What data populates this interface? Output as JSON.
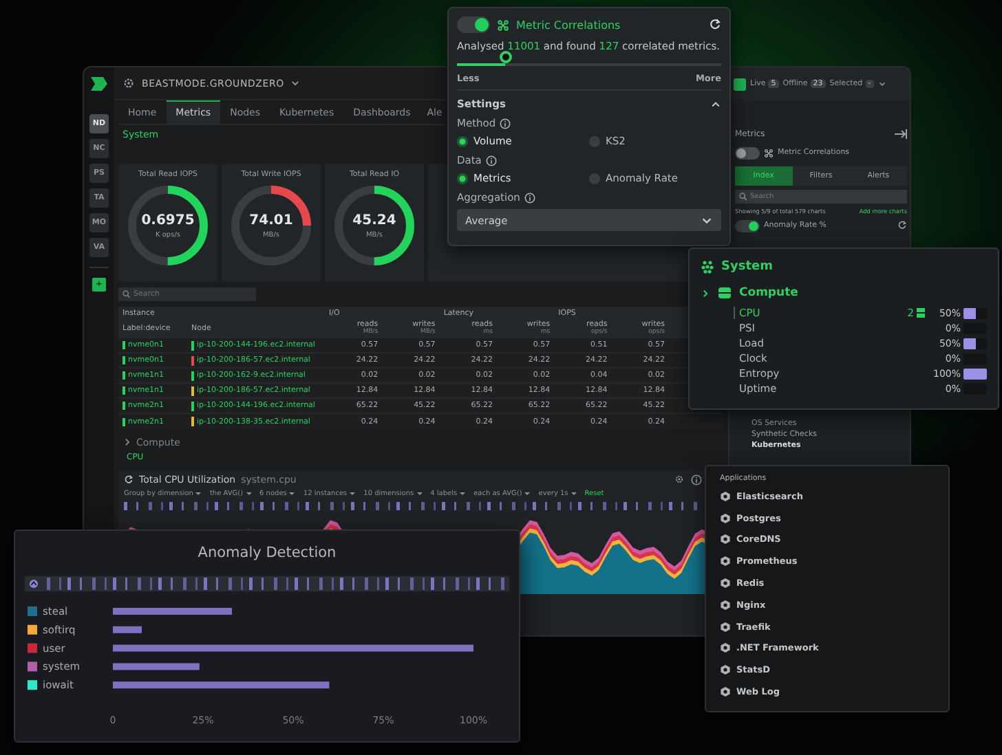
{
  "dashboard": {
    "space_name": "BEASTMODE.GROUNDZERO",
    "node_badges": [
      {
        "label": "ND",
        "selected": true
      },
      {
        "label": "NC",
        "selected": false
      },
      {
        "label": "PS",
        "selected": false
      },
      {
        "label": "TA",
        "selected": false
      },
      {
        "label": "MO",
        "selected": false
      },
      {
        "label": "VA",
        "selected": false
      }
    ],
    "add_button": "+",
    "tabs": [
      {
        "label": "Home",
        "selected": false
      },
      {
        "label": "Metrics",
        "selected": true
      },
      {
        "label": "Nodes",
        "selected": false
      },
      {
        "label": "Kubernetes",
        "selected": false
      },
      {
        "label": "Dashboards",
        "selected": false
      },
      {
        "label": "Ale",
        "selected": false
      }
    ],
    "breadcrumb": "System",
    "gauges": [
      {
        "title": "Total Read IOPS",
        "value": "0.6975",
        "unit": "K ops/s",
        "level": 0.5,
        "color": "#22d35c"
      },
      {
        "title": "Total Write IOPS",
        "value": "74.01",
        "unit": "MB/s",
        "level": 0.25,
        "color": "#e5484d"
      },
      {
        "title": "Total Read IO",
        "value": "45.24",
        "unit": "MB/s",
        "level": 0.5,
        "color": "#22d35c"
      }
    ],
    "search": {
      "placeholder": "Search"
    },
    "table": {
      "groups": [
        "Instance",
        "I/O",
        "Latency",
        "IOPS"
      ],
      "columns": [
        {
          "label": "Label:device"
        },
        {
          "label": "Node"
        },
        {
          "label": "reads",
          "unit": "MB/s"
        },
        {
          "label": "writes",
          "unit": "MB/s"
        },
        {
          "label": "reads",
          "unit": "ms"
        },
        {
          "label": "writes",
          "unit": "ms"
        },
        {
          "label": "reads",
          "unit": "ops/s"
        },
        {
          "label": "writes",
          "unit": "ops/s"
        }
      ],
      "rows": [
        {
          "device": "nvme0n1",
          "node": "ip-10-200-144-196.ec2.internal",
          "color": "#22d35c",
          "values": [
            "0.57",
            "0.57",
            "0.57",
            "0.57",
            "0.51",
            "0.57"
          ]
        },
        {
          "device": "nvme0n1",
          "node": "ip-10-200-186-57.ec2.internal",
          "color": "#e5484d",
          "values": [
            "24.22",
            "24.22",
            "24.22",
            "24.22",
            "24.22",
            "24.22"
          ]
        },
        {
          "device": "nvme1n1",
          "node": "ip-10-200-162-9.ec2.internal",
          "color": "#22d35c",
          "values": [
            "0.02",
            "0.02",
            "0.02",
            "0.02",
            "0.04",
            "0.02"
          ]
        },
        {
          "device": "nvme1n1",
          "node": "ip-10-200-186-57.ec2.internal",
          "color": "#e5b73b",
          "values": [
            "12.84",
            "12.84",
            "12.84",
            "12.84",
            "12.84",
            "12.84"
          ]
        },
        {
          "device": "nvme2n1",
          "node": "ip-10-200-144-196.ec2.internal",
          "color": "#22d35c",
          "values": [
            "65.22",
            "45.22",
            "65.22",
            "65.22",
            "65.22",
            "45.22"
          ]
        },
        {
          "device": "nvme2n1",
          "node": "ip-10-200-138-35.ec2.internal",
          "color": "#e5b73b",
          "values": [
            "0.24",
            "0.24",
            "0.24",
            "0.24",
            "0.24",
            "0.24"
          ]
        }
      ]
    },
    "section": "Compute",
    "subsection": "CPU",
    "chart": {
      "title": "Total CPU Utilization",
      "context": "system.cpu",
      "filters": [
        "Group by dimension",
        "the AVG()",
        "6 nodes",
        "12 instances",
        "10 dimensions",
        "4 labels",
        "each as AVG()",
        "every 1s"
      ],
      "reset": "Reset"
    }
  },
  "status": {
    "live_label": "Live",
    "live_count": "5",
    "offline_label": "Offline",
    "offline_count": "23",
    "selected_label": "Selected",
    "selected_value": "-"
  },
  "right_panel": {
    "title": "Metrics",
    "correlations_toggle": {
      "label": "Metric Correlations",
      "on": false
    },
    "tabs": [
      {
        "label": "Index",
        "selected": true
      },
      {
        "label": "Filters",
        "selected": false
      },
      {
        "label": "Alerts",
        "selected": false
      }
    ],
    "search": {
      "placeholder": "Search"
    },
    "showing": "Showing 5/9 of total 579 charts",
    "add_more": "Add more charts",
    "anomaly_toggle": {
      "label": "Anomaly Rate %",
      "on": true
    },
    "items": [
      "OS Services",
      "Synthetic Checks",
      "Kubernetes"
    ]
  },
  "correlations": {
    "enabled": true,
    "title": "Metric Correlations",
    "summary": [
      {
        "text": "Analysed ",
        "highlight": false
      },
      {
        "text": "11001",
        "highlight": true
      },
      {
        "text": " and found ",
        "highlight": false
      },
      {
        "text": "127",
        "highlight": true
      },
      {
        "text": " correlated metrics.",
        "highlight": false
      }
    ],
    "sensitivity": {
      "level": 0.18,
      "min_label": "Less",
      "max_label": "More"
    },
    "settings": {
      "title": "Settings",
      "expanded": true
    },
    "method": {
      "label": "Method",
      "options": [
        {
          "label": "Volume",
          "selected": true
        },
        {
          "label": "KS2",
          "selected": false
        }
      ]
    },
    "data": {
      "label": "Data",
      "options": [
        {
          "label": "Metrics",
          "selected": true
        },
        {
          "label": "Anomaly Rate",
          "selected": false
        }
      ]
    },
    "aggregation": {
      "label": "Aggregation",
      "value": "Average"
    }
  },
  "system_menu": {
    "title": "System",
    "group": "Compute",
    "items": [
      {
        "label": "CPU",
        "count": "2",
        "value": "50%",
        "level": 0.5,
        "selected": true
      },
      {
        "label": "PSI",
        "value": "0%",
        "level": 0,
        "selected": false
      },
      {
        "label": "Load",
        "value": "50%",
        "level": 0.5,
        "selected": false
      },
      {
        "label": "Clock",
        "value": "0%",
        "level": 0,
        "selected": false
      },
      {
        "label": "Entropy",
        "value": "100%",
        "level": 1,
        "selected": false
      },
      {
        "label": "Uptime",
        "value": "0%",
        "level": 0,
        "selected": false
      }
    ]
  },
  "applications": {
    "title": "Applications",
    "items": [
      "Elasticsearch",
      "Postgres",
      "CoreDNS",
      "Prometheus",
      "Redis",
      "Nginx",
      "Traefik",
      ".NET Framework",
      "StatsD",
      "Web Log"
    ]
  },
  "anomaly_detection": {
    "title": "Anomaly Detection",
    "legend": [
      {
        "color": "#1f6f8a"
      },
      {
        "color": "#f5a83a"
      },
      {
        "color": "#c8283a"
      },
      {
        "color": "#b060a8"
      },
      {
        "color": "#2ee6c8"
      }
    ],
    "chart_data": {
      "type": "bar",
      "orientation": "horizontal",
      "categories": [
        "steal",
        "softirq",
        "user",
        "system",
        "iowait"
      ],
      "values": [
        33,
        8,
        100,
        24,
        60
      ],
      "xlim": [
        0,
        100
      ],
      "xticks": [
        {
          "value": 0,
          "label": "0"
        },
        {
          "value": 25,
          "label": "25%"
        },
        {
          "value": 50,
          "label": "50%"
        },
        {
          "value": 75,
          "label": "75%"
        },
        {
          "value": 100,
          "label": "100%"
        }
      ]
    }
  }
}
